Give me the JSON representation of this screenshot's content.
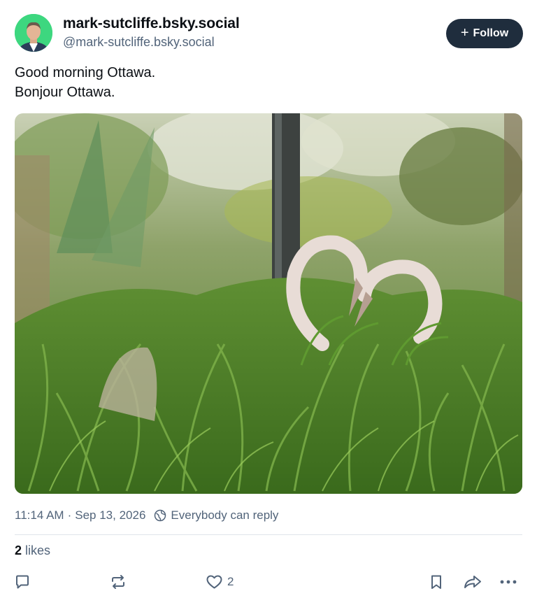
{
  "author": {
    "display_name": "mark-sutcliffe.bsky.social",
    "handle": "@mark-sutcliffe.bsky.social",
    "avatar_bg": "#3dd77f"
  },
  "follow_button": {
    "icon": "plus-icon",
    "label": "Follow"
  },
  "post": {
    "lines": [
      "Good morning Ottawa.",
      "Bonjour Ottawa."
    ]
  },
  "image": {
    "description_icon": "photo-heart-swans"
  },
  "meta": {
    "time": "11:14 AM",
    "separator": "·",
    "date": "Sep 13, 2026",
    "reply_icon": "globe-icon",
    "reply_setting": "Everybody can reply"
  },
  "stats": {
    "likes_count": "2",
    "likes_label": "likes"
  },
  "actions": {
    "reply": {
      "icon": "reply-bubble-icon"
    },
    "repost": {
      "icon": "repost-icon"
    },
    "like": {
      "icon": "heart-icon",
      "count": "2"
    },
    "bookmark": {
      "icon": "bookmark-icon"
    },
    "share": {
      "icon": "share-arrow-icon"
    },
    "more": {
      "icon": "more-dots-icon"
    }
  },
  "colors": {
    "text_primary": "#0b0f14",
    "text_secondary": "#52647a",
    "button_bg": "#1f2d3d",
    "divider": "#dfe4ea"
  }
}
